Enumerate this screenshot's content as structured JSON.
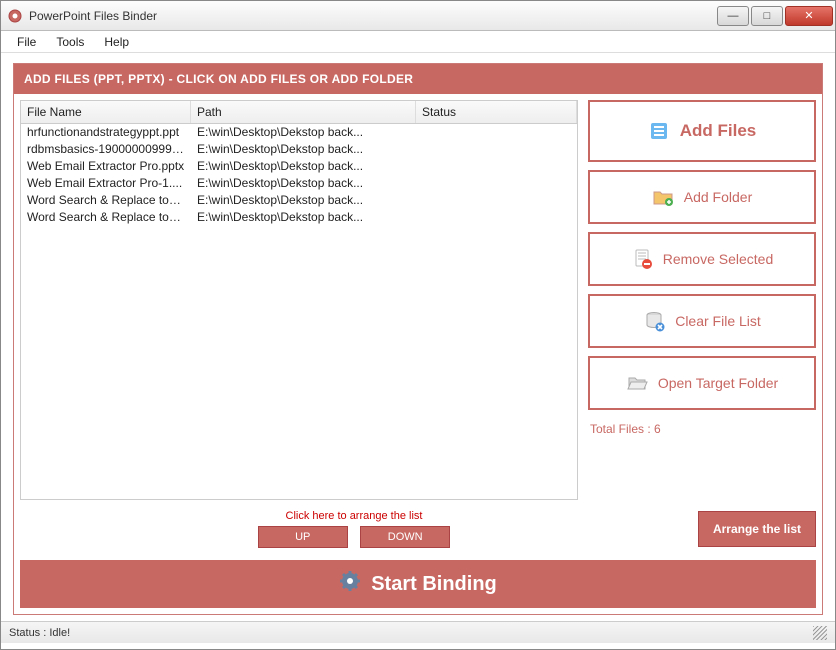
{
  "window": {
    "title": "PowerPoint Files Binder"
  },
  "menu": {
    "file": "File",
    "tools": "Tools",
    "help": "Help"
  },
  "banner": "ADD FILES (PPT, PPTX) - CLICK ON ADD FILES OR ADD FOLDER",
  "columns": {
    "name": "File Name",
    "path": "Path",
    "status": "Status"
  },
  "rows": [
    {
      "name": "hrfunctionandstrategyppt.ppt",
      "path": "E:\\win\\Desktop\\Dekstop back...",
      "status": ""
    },
    {
      "name": "rdbmsbasics-19000000999....",
      "path": "E:\\win\\Desktop\\Dekstop back...",
      "status": ""
    },
    {
      "name": "Web Email Extractor Pro.pptx",
      "path": "E:\\win\\Desktop\\Dekstop back...",
      "status": ""
    },
    {
      "name": "Web Email Extractor Pro-1....",
      "path": "E:\\win\\Desktop\\Dekstop back...",
      "status": ""
    },
    {
      "name": "Word Search & Replace too...",
      "path": "E:\\win\\Desktop\\Dekstop back...",
      "status": ""
    },
    {
      "name": "Word Search & Replace too...",
      "path": "E:\\win\\Desktop\\Dekstop back...",
      "status": ""
    }
  ],
  "side": {
    "add_files": "Add Files",
    "add_folder": "Add Folder",
    "remove_selected": "Remove Selected",
    "clear_list": "Clear File List",
    "open_target": "Open Target Folder",
    "total_label": "Total Files : 6"
  },
  "arrange": {
    "hint": "Click here to arrange the list",
    "up": "UP",
    "down": "DOWN",
    "arrange_btn": "Arrange the list"
  },
  "start": "Start Binding",
  "status": "Status  :  Idle!"
}
